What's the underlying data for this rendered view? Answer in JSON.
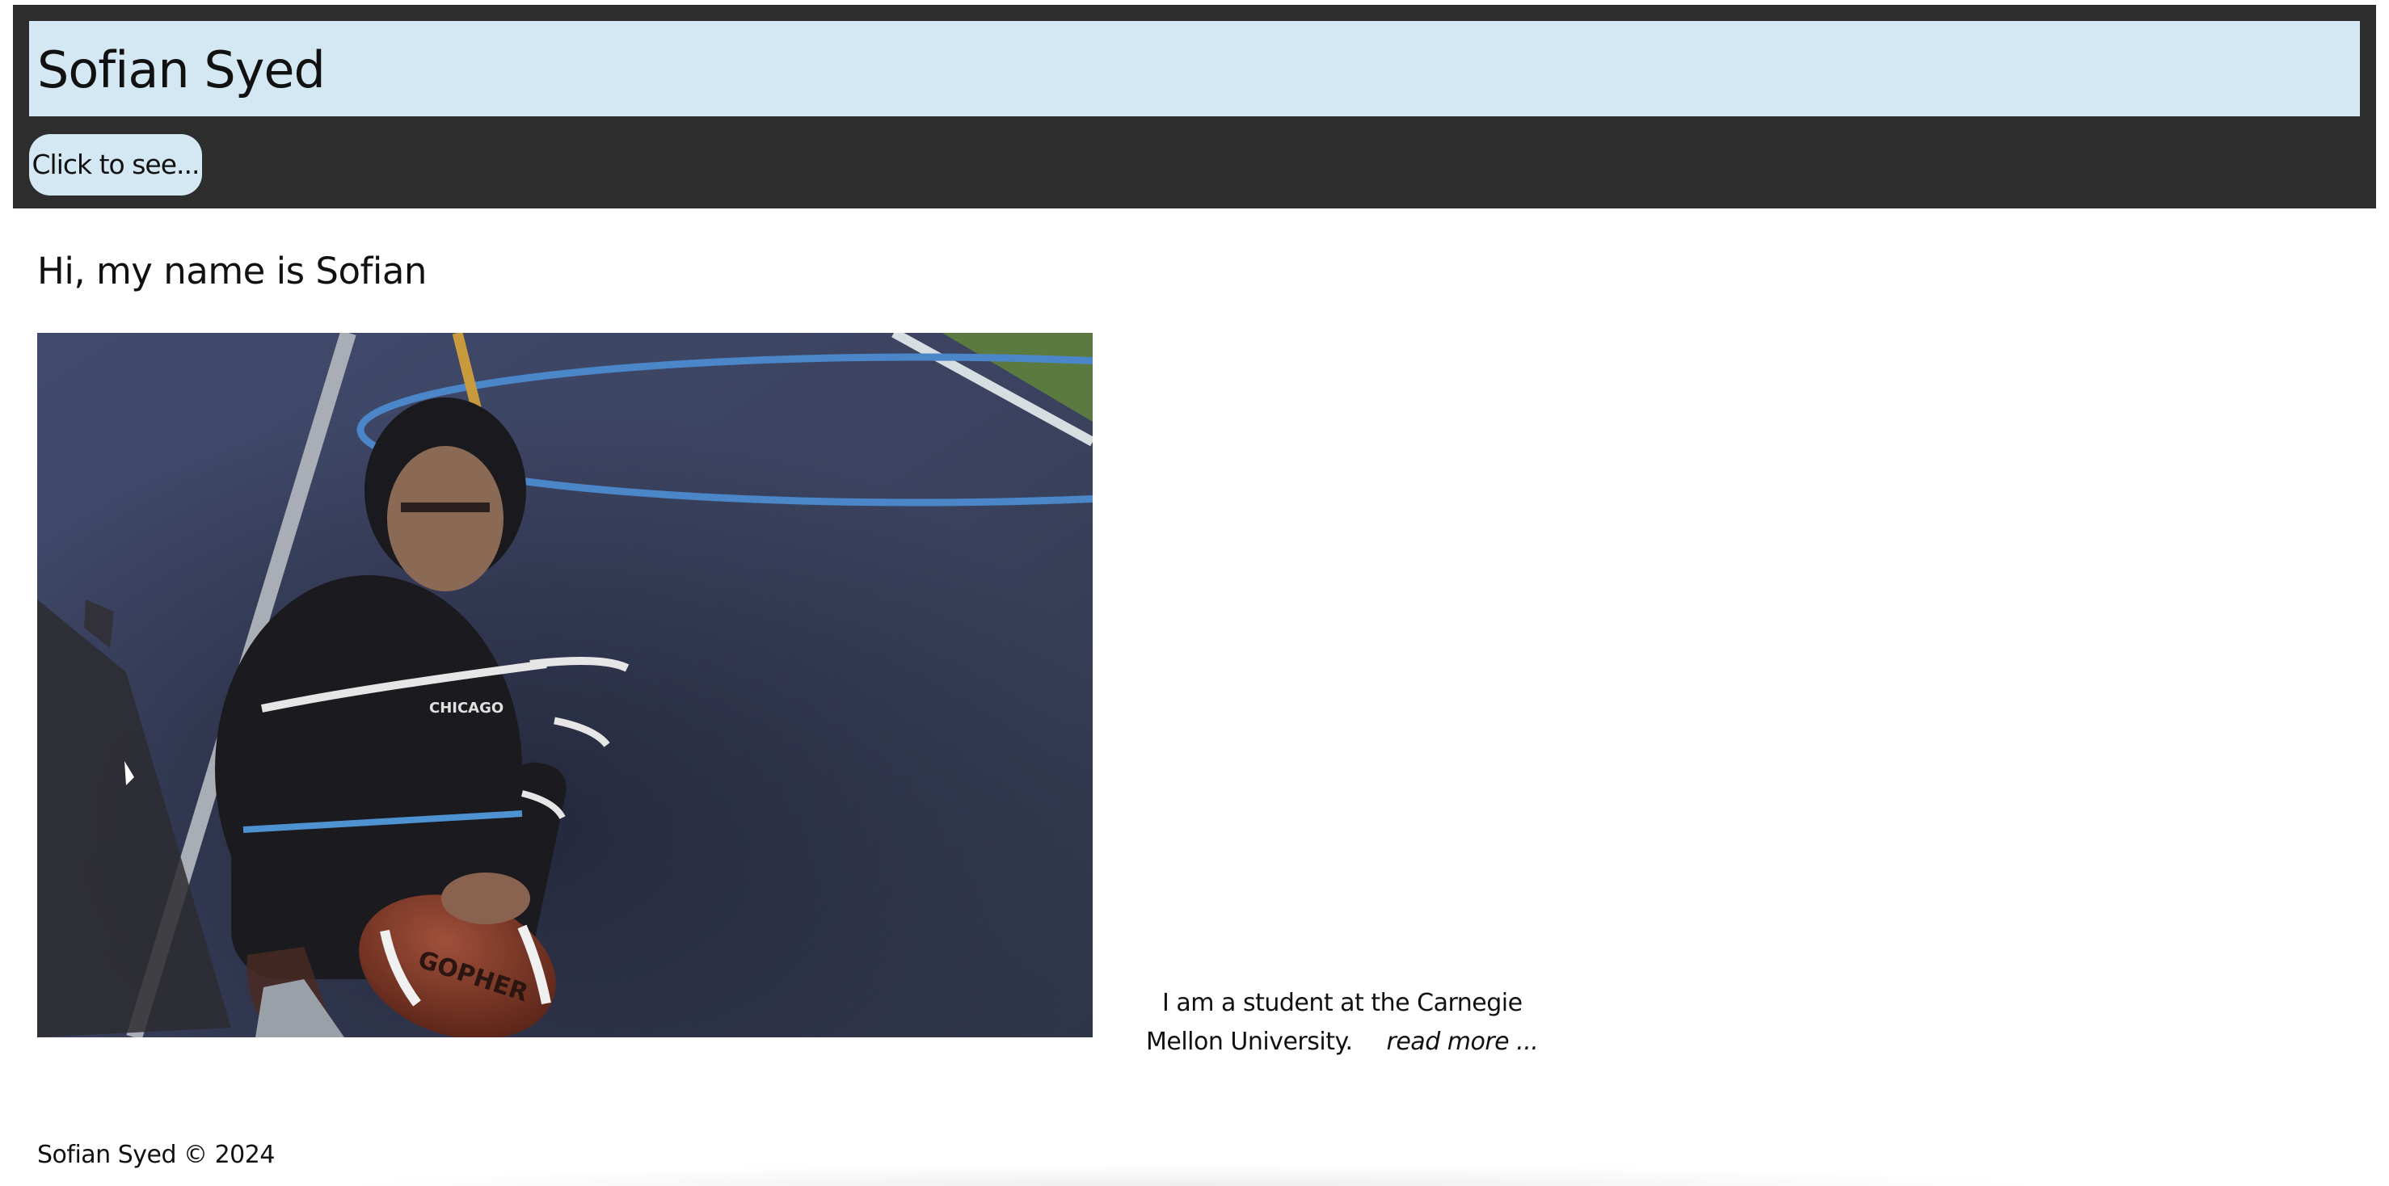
{
  "header": {
    "title": "Sofian Syed",
    "menu_button_label": "Click to see..."
  },
  "main": {
    "greeting": "Hi, my name is Sofian",
    "photo": {
      "ball_text": "GOPHER",
      "shirt_text": "CHICAGO"
    },
    "bio": {
      "text": "I am a student at the Carnegie Mellon University.",
      "read_more_label": "read more ..."
    }
  },
  "footer": {
    "copyright": "Sofian Syed © 2024"
  },
  "colors": {
    "header_background": "#2d2d2d",
    "title_bar_background": "#d4e8f3",
    "button_background": "#d4e8f3",
    "page_background": "#ffffff"
  }
}
